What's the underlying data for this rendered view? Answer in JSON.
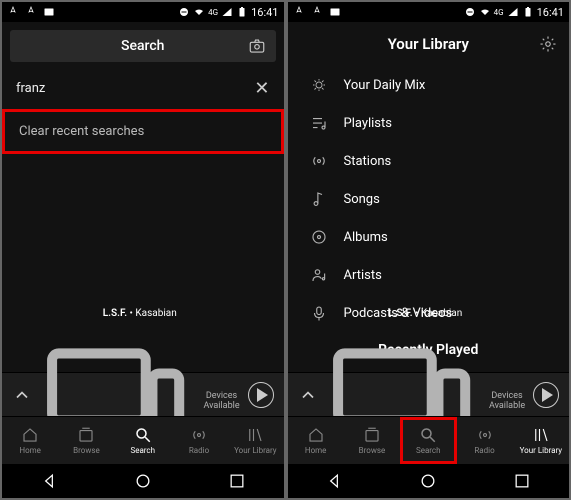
{
  "status": {
    "time": "16:41",
    "network": "4G"
  },
  "left": {
    "search_header": "Search",
    "query": "franz",
    "clear_label": "Clear recent searches"
  },
  "right": {
    "title": "Your Library",
    "items": [
      {
        "label": "Your Daily Mix"
      },
      {
        "label": "Playlists"
      },
      {
        "label": "Stations"
      },
      {
        "label": "Songs"
      },
      {
        "label": "Albums"
      },
      {
        "label": "Artists"
      },
      {
        "label": "Podcasts & Videos"
      }
    ],
    "recently_played": "Recently Played"
  },
  "now_playing": {
    "track": "L.S.F.",
    "artist": "Kasabian",
    "devices": "Devices Available"
  },
  "tabs": {
    "home": "Home",
    "browse": "Browse",
    "search": "Search",
    "radio": "Radio",
    "library": "Your Library"
  }
}
